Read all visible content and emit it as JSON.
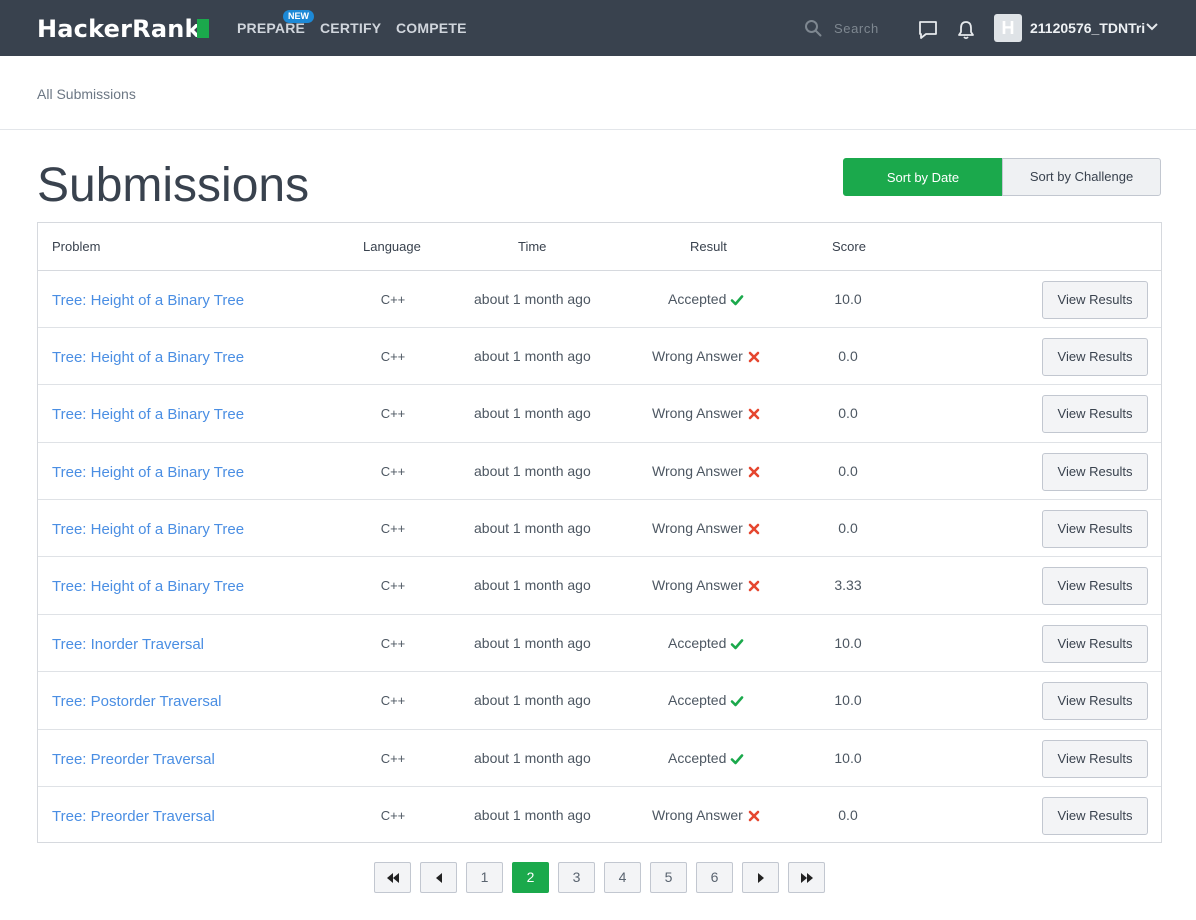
{
  "nav": {
    "logo": "HackerRank",
    "links": [
      "PREPARE",
      "CERTIFY",
      "COMPETE"
    ],
    "new_badge": "NEW",
    "search_placeholder": "Search",
    "avatar_letter": "H",
    "username": "21120576_TDNTri"
  },
  "breadcrumb": "All Submissions",
  "page_title": "Submissions",
  "sort": {
    "by_date": "Sort by Date",
    "by_challenge": "Sort by Challenge",
    "active": "by_date"
  },
  "table": {
    "headers": {
      "problem": "Problem",
      "language": "Language",
      "time": "Time",
      "result": "Result",
      "score": "Score"
    },
    "view_label": "View Results",
    "rows": [
      {
        "problem": "Tree: Height of a Binary Tree",
        "language": "C++",
        "time": "about 1 month ago",
        "result": "Accepted",
        "score": "10.0"
      },
      {
        "problem": "Tree: Height of a Binary Tree",
        "language": "C++",
        "time": "about 1 month ago",
        "result": "Wrong Answer",
        "score": "0.0"
      },
      {
        "problem": "Tree: Height of a Binary Tree",
        "language": "C++",
        "time": "about 1 month ago",
        "result": "Wrong Answer",
        "score": "0.0"
      },
      {
        "problem": "Tree: Height of a Binary Tree",
        "language": "C++",
        "time": "about 1 month ago",
        "result": "Wrong Answer",
        "score": "0.0"
      },
      {
        "problem": "Tree: Height of a Binary Tree",
        "language": "C++",
        "time": "about 1 month ago",
        "result": "Wrong Answer",
        "score": "0.0"
      },
      {
        "problem": "Tree: Height of a Binary Tree",
        "language": "C++",
        "time": "about 1 month ago",
        "result": "Wrong Answer",
        "score": "3.33"
      },
      {
        "problem": "Tree: Inorder Traversal",
        "language": "C++",
        "time": "about 1 month ago",
        "result": "Accepted",
        "score": "10.0"
      },
      {
        "problem": "Tree: Postorder Traversal",
        "language": "C++",
        "time": "about 1 month ago",
        "result": "Accepted",
        "score": "10.0"
      },
      {
        "problem": "Tree: Preorder Traversal",
        "language": "C++",
        "time": "about 1 month ago",
        "result": "Accepted",
        "score": "10.0"
      },
      {
        "problem": "Tree: Preorder Traversal",
        "language": "C++",
        "time": "about 1 month ago",
        "result": "Wrong Answer",
        "score": "0.0"
      }
    ]
  },
  "pagination": {
    "pages": [
      "1",
      "2",
      "3",
      "4",
      "5",
      "6"
    ],
    "current": "2"
  },
  "colors": {
    "accent": "#1ba94c",
    "nav_bg": "#39424e",
    "link": "#4a8ee3",
    "wrong": "#e5462f"
  }
}
